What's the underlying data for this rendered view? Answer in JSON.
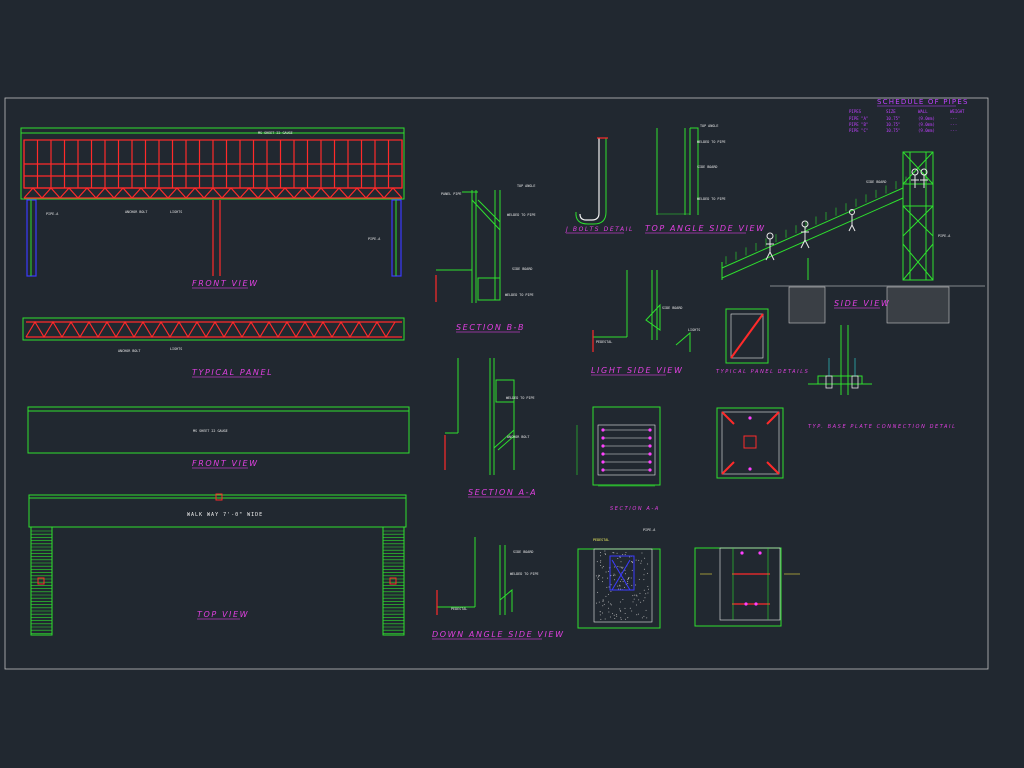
{
  "titles": {
    "front_view": "FRONT VIEW",
    "typical_panel": "TYPICAL PANEL",
    "front_view_2": "FRONT VIEW",
    "top_view": "TOP VIEW",
    "section_b": "SECTION B-B",
    "section_a": "SECTION A-A",
    "down_angle": "DOWN ANGLE SIDE VIEW",
    "j_bolts": "J BOLTS DETAIL",
    "top_angle": "TOP ANGLE SIDE VIEW",
    "light_side": "LIGHT SIDE VIEW",
    "typical_panel_details": "TYPICAL PANEL DETAILS",
    "section_a_small": "SECTION A-A",
    "base_plate": "TYP. BASE PLATE CONNECTION DETAIL",
    "side_view": "SIDE VIEW"
  },
  "schedule": {
    "title": "SCHEDULE OF PIPES",
    "headers": [
      "PIPES",
      "SIZE",
      "WALL",
      "WEIGHT"
    ],
    "rows": [
      [
        "PIPE \"A\"",
        "10.75\"",
        "(9.0mm)",
        "---"
      ],
      [
        "PIPE \"B\"",
        "10.75\"",
        "(9.0mm)",
        "---"
      ],
      [
        "PIPE \"C\"",
        "10.75\"",
        "(9.0mm)",
        "---"
      ]
    ]
  },
  "notes": {
    "walkway": "WALK WAY 7'-0\" WIDE",
    "ms_sheet": "MS SHEET 22 GAUGE",
    "welded_to_pipe": "WELDED TO PIPE",
    "top_angle": "TOP ANGLE",
    "panel_pipe": "PANEL PIPE",
    "side_board": "SIDE BOARD",
    "pipe_a": "PIPE-A",
    "lights": "LIGHTS",
    "anchor_bolt": "ANCHOR BOLT",
    "pedestal": "PEDESTAL"
  }
}
